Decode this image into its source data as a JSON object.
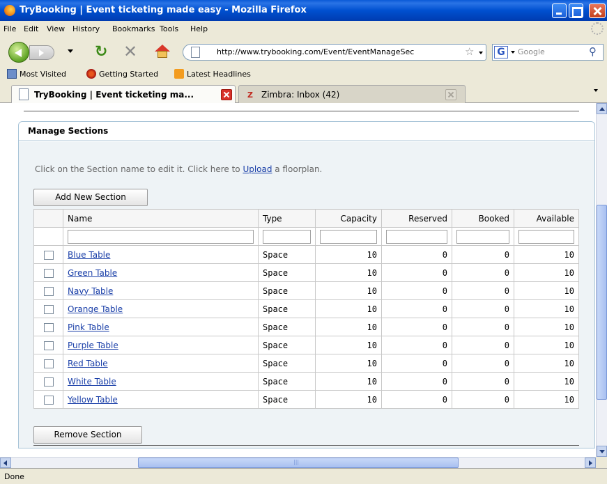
{
  "window": {
    "title": "TryBooking | Event ticketing made easy - Mozilla Firefox"
  },
  "menu": [
    "File",
    "Edit",
    "View",
    "History",
    "Bookmarks",
    "Tools",
    "Help"
  ],
  "nav": {
    "url": "http://www.trybooking.com/Event/EventManageSec",
    "search_placeholder": "Google"
  },
  "bookmarks": [
    "Most Visited",
    "Getting Started",
    "Latest Headlines"
  ],
  "tabs": [
    {
      "label": "TryBooking | Event ticketing ma...",
      "active": true
    },
    {
      "label": "Zimbra: Inbox (42)",
      "active": false
    }
  ],
  "panel": {
    "title": "Manage Sections",
    "hint_before": "Click on the Section name to edit it. Click here to ",
    "hint_link": "Upload",
    "hint_after": " a floorplan.",
    "add_button": "Add New Section",
    "remove_button": "Remove Section"
  },
  "table": {
    "columns": [
      "Name",
      "Type",
      "Capacity",
      "Reserved",
      "Booked",
      "Available"
    ],
    "rows": [
      {
        "name": "Blue Table",
        "type": "Space",
        "capacity": "10",
        "reserved": "0",
        "booked": "0",
        "available": "10"
      },
      {
        "name": "Green Table",
        "type": "Space",
        "capacity": "10",
        "reserved": "0",
        "booked": "0",
        "available": "10"
      },
      {
        "name": "Navy Table",
        "type": "Space",
        "capacity": "10",
        "reserved": "0",
        "booked": "0",
        "available": "10"
      },
      {
        "name": "Orange Table",
        "type": "Space",
        "capacity": "10",
        "reserved": "0",
        "booked": "0",
        "available": "10"
      },
      {
        "name": "Pink Table",
        "type": "Space",
        "capacity": "10",
        "reserved": "0",
        "booked": "0",
        "available": "10"
      },
      {
        "name": "Purple Table",
        "type": "Space",
        "capacity": "10",
        "reserved": "0",
        "booked": "0",
        "available": "10"
      },
      {
        "name": "Red Table",
        "type": "Space",
        "capacity": "10",
        "reserved": "0",
        "booked": "0",
        "available": "10"
      },
      {
        "name": "White Table",
        "type": "Space",
        "capacity": "10",
        "reserved": "0",
        "booked": "0",
        "available": "10"
      },
      {
        "name": "Yellow Table",
        "type": "Space",
        "capacity": "10",
        "reserved": "0",
        "booked": "0",
        "available": "10"
      }
    ]
  },
  "status": {
    "text": "Done"
  },
  "colors": {
    "titlebar": "#0050d0",
    "link": "#1a3fa8",
    "panel_border": "#a8c4d8"
  }
}
